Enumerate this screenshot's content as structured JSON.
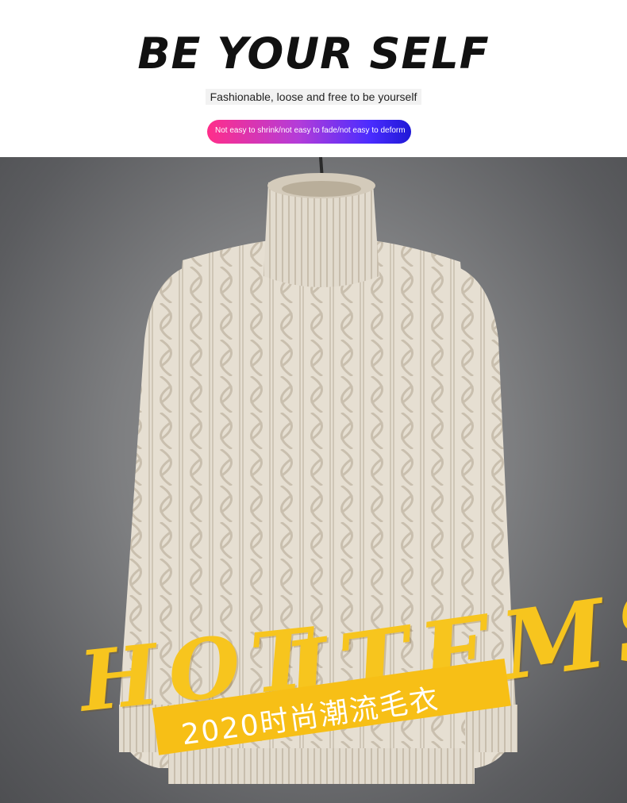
{
  "header": {
    "title": "BE YOUR SELF",
    "subtitle": "Fashionable, loose and free to be yourself",
    "pill_text": "Not easy to shrink/not easy to fade/not easy to deform"
  },
  "hero": {
    "headline": "HOT ITEMS",
    "headline_words": [
      "HOT",
      "ITEMS"
    ],
    "banner_text": "2020时尚潮流毛衣",
    "product": "cable-knit turtleneck sweater on hanger"
  },
  "colors": {
    "accent_yellow": "#f7c51e",
    "background_gray": "#7d7e80",
    "sweater": "#e4ddd0",
    "pill_gradient_start": "#ff2e8a",
    "pill_gradient_end": "#1f18d6"
  }
}
